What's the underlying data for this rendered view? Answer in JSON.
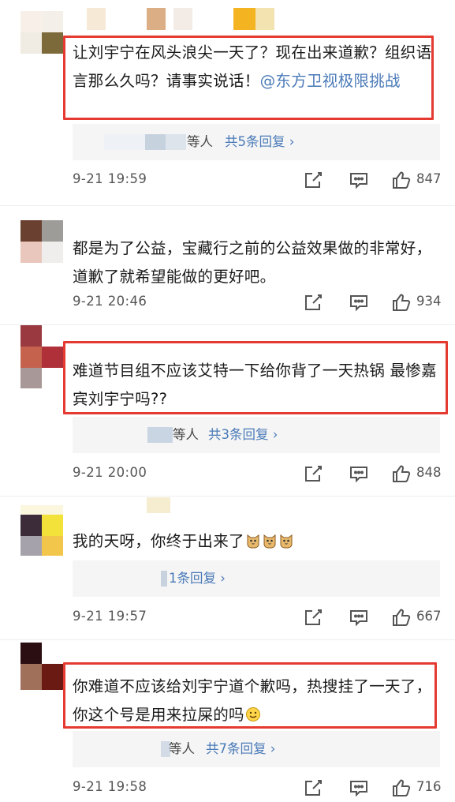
{
  "comments": [
    {
      "text": "让刘宇宁在风头浪尖一天了？现在出来道歉？组织语言那么久吗？请事实说话！",
      "mention": "@东方卫视极限挑战",
      "reply_who": "等人",
      "reply_total": "共5条回复 ",
      "time": "9-21 19:59",
      "likes": "847"
    },
    {
      "text": "都是为了公益，宝藏行之前的公益效果做的非常好，道歉了就希望能做的更好吧。",
      "time": "9-21 20:46",
      "likes": "934"
    },
    {
      "text": "难道节目组不应该艾特一下给你背了一天热锅 最惨嘉宾刘宇宁吗??",
      "reply_who": "等人",
      "reply_total": "共3条回复 ",
      "time": "9-21 20:00",
      "likes": "848"
    },
    {
      "text": "我的天呀，你终于出来了",
      "reply_who": "",
      "reply_total": "1条回复 ",
      "time": "9-21 19:57",
      "likes": "667"
    },
    {
      "text": "你难道不应该给刘宇宁道个歉吗，热搜挂了一天了，你这个号是用来拉屎的吗",
      "reply_who": "等人",
      "reply_total": "共7条回复 ",
      "time": "9-21 19:58",
      "likes": "716"
    }
  ],
  "icons": {
    "share": "share-icon",
    "comment": "comment-icon",
    "like": "thumbs-up-icon",
    "chevron": "chevron-right-icon",
    "emoji": "cat-emoji-icon",
    "smile": "smile-emoji-icon"
  },
  "colors": {
    "highlight_box": "#e53a31",
    "link": "#4a7ab8",
    "reply_bg": "#f5f5f5"
  }
}
